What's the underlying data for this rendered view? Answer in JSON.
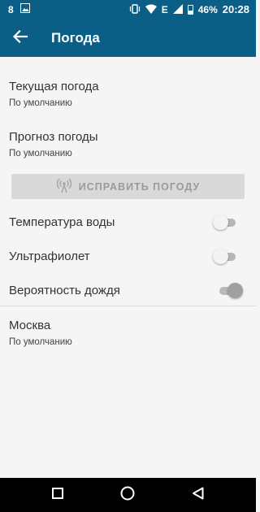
{
  "status_bar": {
    "left_number": "8",
    "signal_letter": "E",
    "battery_percent": "46%",
    "time": "20:28"
  },
  "app_bar": {
    "title": "Погода"
  },
  "prefs": {
    "current_weather": {
      "title": "Текущая погода",
      "summary": "По умолчанию"
    },
    "forecast": {
      "title": "Прогноз погоды",
      "summary": "По умолчанию"
    },
    "fix_button": {
      "label": "ИСПРАВИТЬ ПОГОДУ"
    },
    "water_temp": {
      "title": "Температура воды",
      "enabled": false
    },
    "ultraviolet": {
      "title": "Ультрафиолет",
      "enabled": false
    },
    "rain_probability": {
      "title": "Вероятность дождя",
      "enabled": true
    },
    "city": {
      "title": "Москва",
      "summary": "По умолчанию"
    }
  },
  "colors": {
    "primary": "#0b5f86",
    "background": "#f5f5f5",
    "button_disabled": "#d9d9d9"
  },
  "icons": [
    "arrow-back-icon",
    "antenna-icon",
    "square-recents-icon",
    "circle-home-icon",
    "triangle-back-icon"
  ]
}
